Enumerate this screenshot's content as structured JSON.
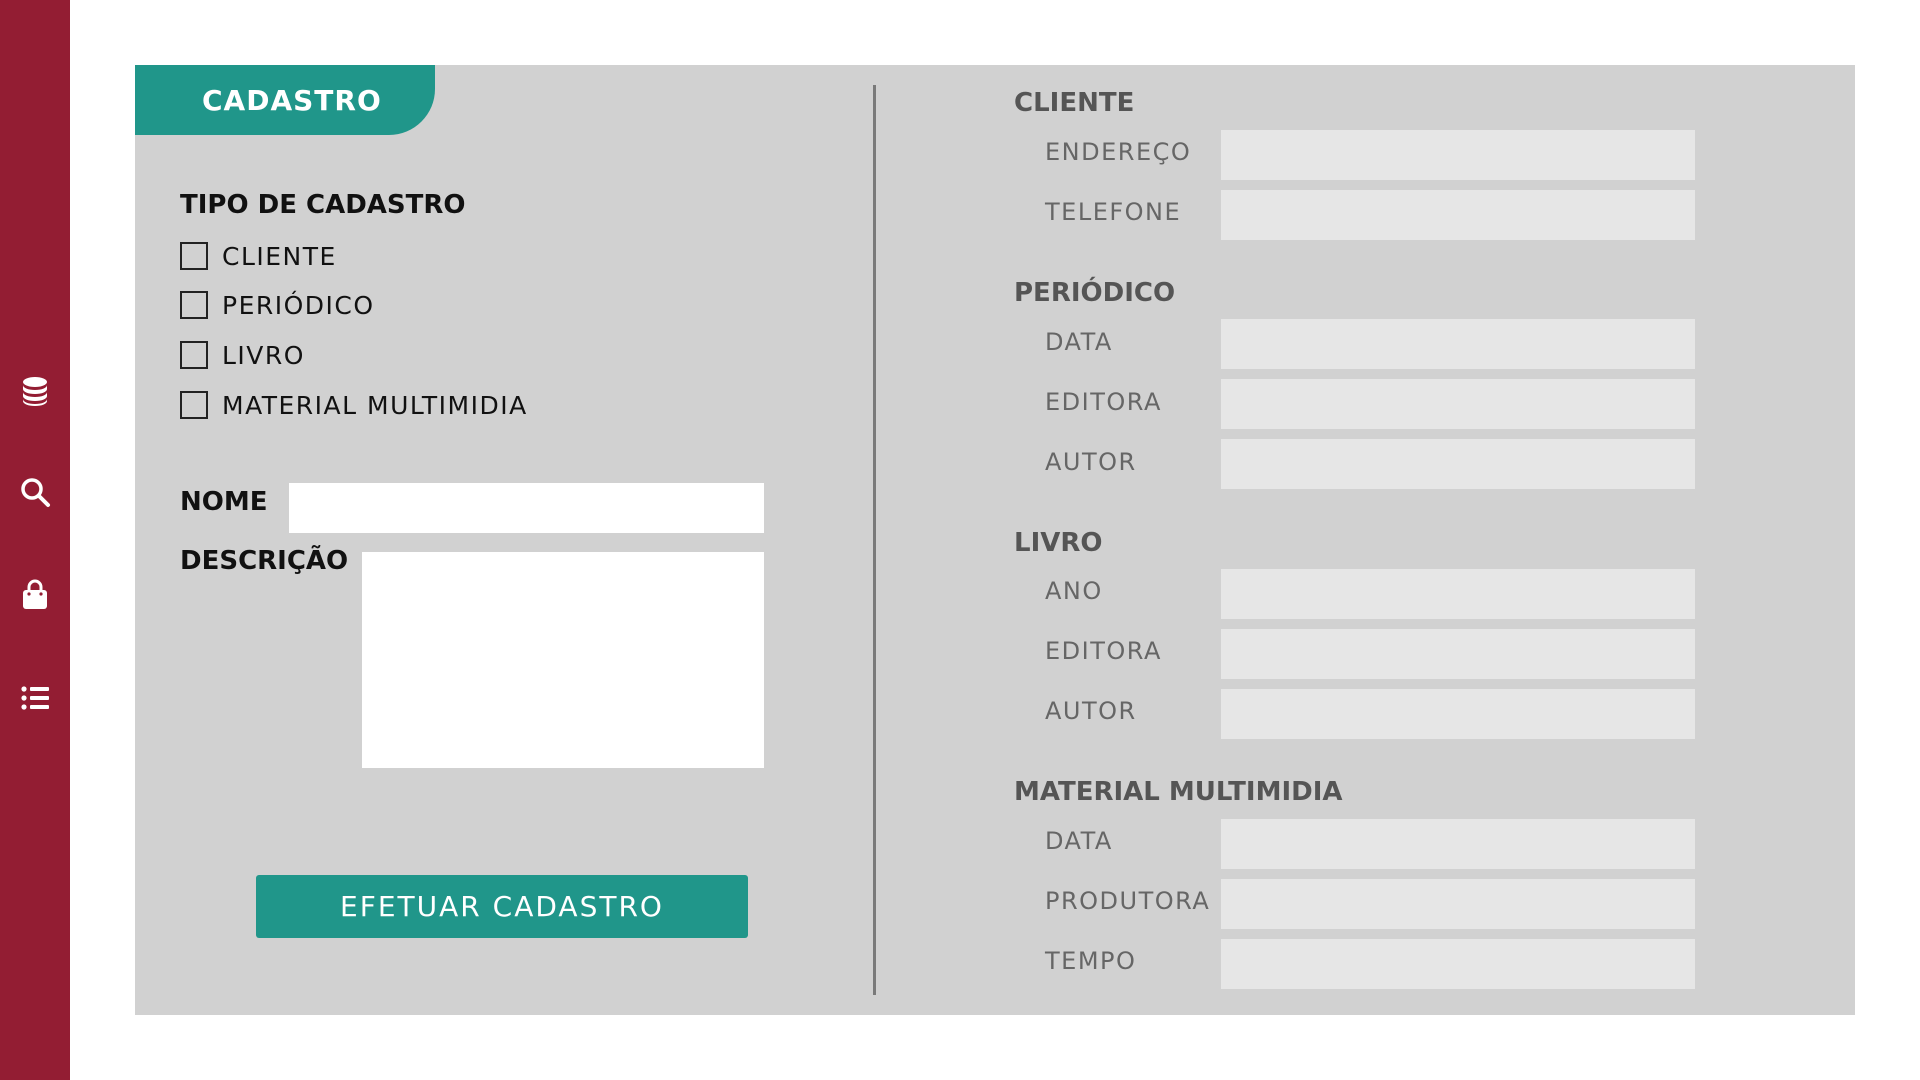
{
  "sidebar": {
    "icons": [
      "database-icon",
      "search-icon",
      "shopping-bag-icon",
      "list-icon"
    ]
  },
  "panel": {
    "tab_label": "CADASTRO"
  },
  "tipo": {
    "title": "TIPO DE CADASTRO",
    "options": [
      "CLIENTE",
      "PERIÓDICO",
      "LIVRO",
      "MATERIAL MULTIMIDIA"
    ]
  },
  "form": {
    "nome_label": "NOME",
    "nome_value": "",
    "descricao_label": "DESCRIÇÃO",
    "descricao_value": "",
    "submit_label": "EFETUAR CADASTRO"
  },
  "groups": {
    "cliente": {
      "title": "CLIENTE",
      "fields": [
        "ENDEREÇO",
        "TELEFONE"
      ]
    },
    "periodico": {
      "title": "PERIÓDICO",
      "fields": [
        "DATA",
        "EDITORA",
        "AUTOR"
      ]
    },
    "livro": {
      "title": "LIVRO",
      "fields": [
        "ANO",
        "EDITORA",
        "AUTOR"
      ]
    },
    "multimidia": {
      "title": "MATERIAL MULTIMIDIA",
      "fields": [
        "DATA",
        "PRODUTORA",
        "TEMPO"
      ]
    }
  },
  "colors": {
    "sidebar": "#931d33",
    "accent": "#20968a",
    "panel": "#d1d1d1",
    "field": "#e6e6e6"
  }
}
